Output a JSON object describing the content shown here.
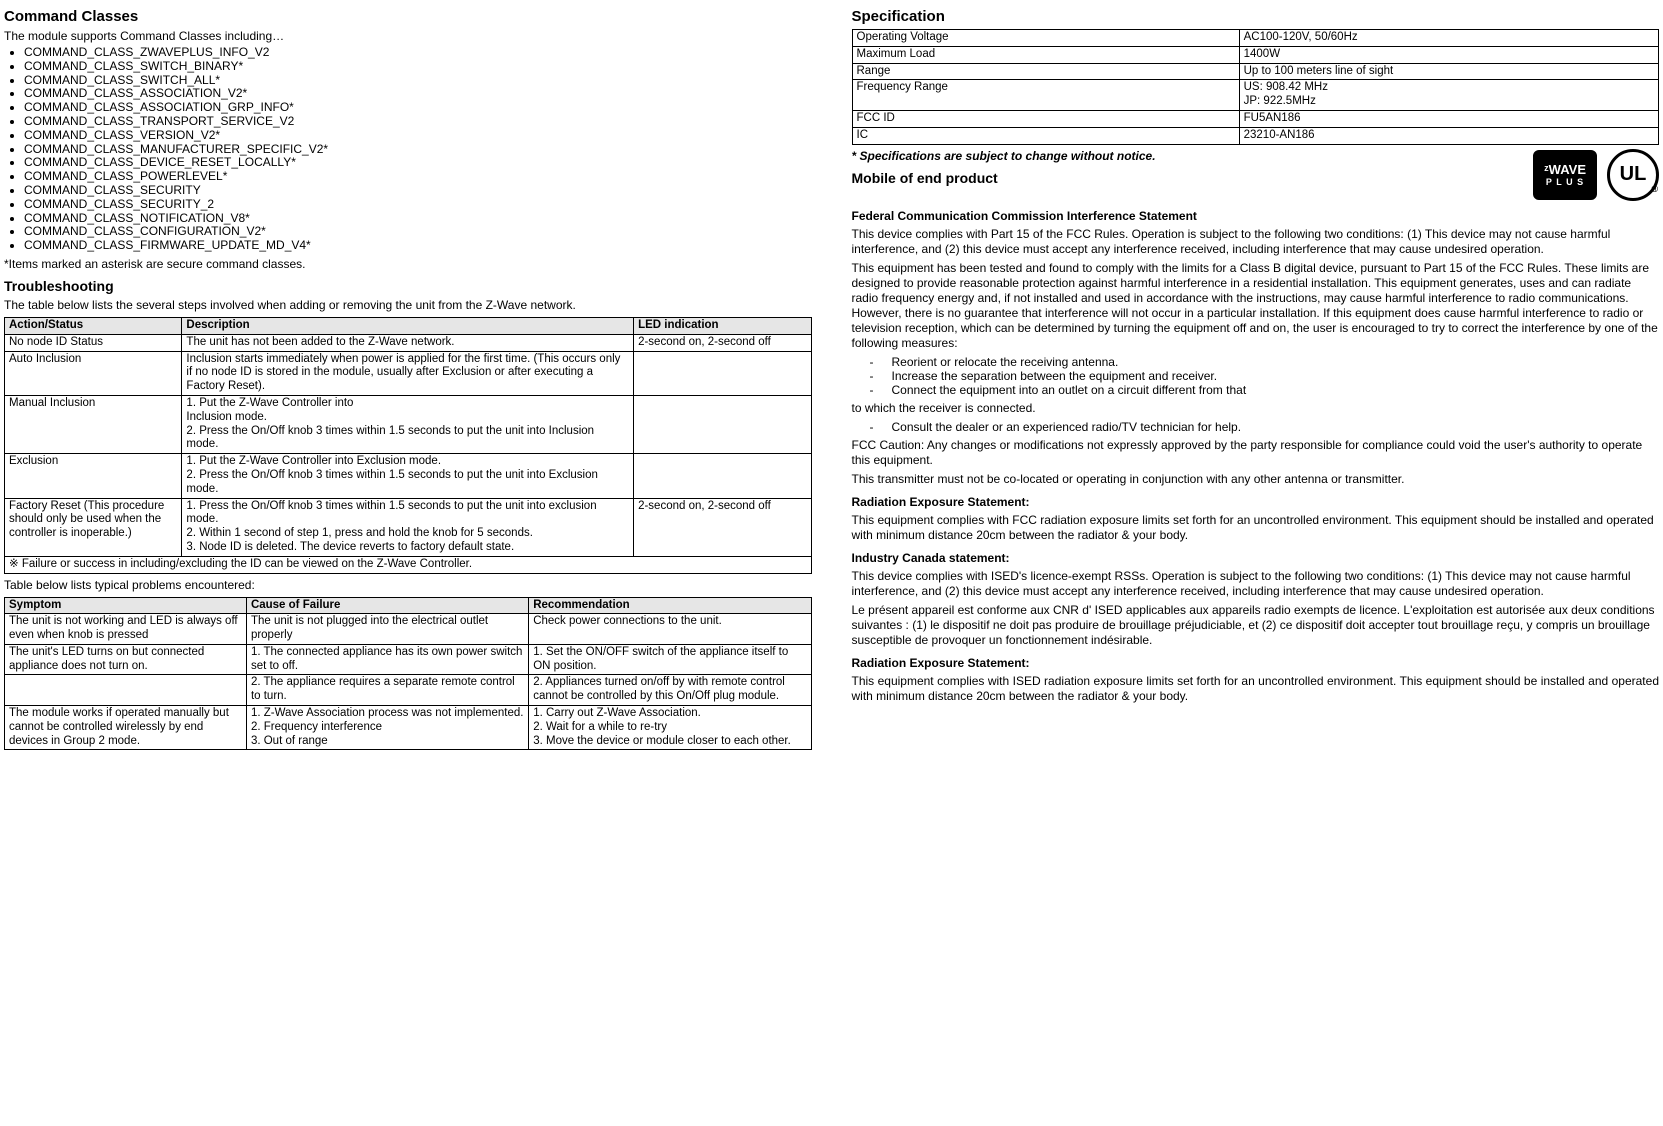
{
  "left": {
    "title1": "Command Classes",
    "intro1": "The module supports Command Classes including…",
    "commands": [
      "COMMAND_CLASS_ZWAVEPLUS_INFO_V2",
      "COMMAND_CLASS_SWITCH_BINARY*",
      "COMMAND_CLASS_SWITCH_ALL*",
      "COMMAND_CLASS_ASSOCIATION_V2*",
      "COMMAND_CLASS_ASSOCIATION_GRP_INFO*",
      "COMMAND_CLASS_TRANSPORT_SERVICE_V2",
      "COMMAND_CLASS_VERSION_V2*",
      "COMMAND_CLASS_MANUFACTURER_SPECIFIC_V2*",
      "COMMAND_CLASS_DEVICE_RESET_LOCALLY*",
      "COMMAND_CLASS_POWERLEVEL*",
      "COMMAND_CLASS_SECURITY",
      "COMMAND_CLASS_SECURITY_2",
      "COMMAND_CLASS_NOTIFICATION_V8*",
      "COMMAND_CLASS_CONFIGURATION_V2*",
      "COMMAND_CLASS_FIRMWARE_UPDATE_MD_V4*"
    ],
    "asterisk_note": "*Items marked an asterisk are secure command classes.",
    "title2": "Troubleshooting",
    "intro2": "The table below lists the several steps involved when adding or removing the unit   from the Z-Wave network.",
    "t1_headers": [
      "Action/Status",
      "Description",
      "LED indication"
    ],
    "t1_rows": [
      [
        "No node ID Status",
        "The unit has not been added to the Z-Wave network.",
        "2-second on, 2-second off"
      ],
      [
        "Auto Inclusion",
        "Inclusion starts immediately when power is applied for the first time. (This occurs only if no node ID is stored in the module, usually after Exclusion or after executing a Factory Reset).",
        ""
      ],
      [
        "Manual Inclusion",
        "1.  Put the Z-Wave Controller into\n        Inclusion mode.\n2.  Press the On/Off knob 3 times within 1.5 seconds to put the unit into Inclusion mode.",
        ""
      ],
      [
        "Exclusion",
        "1. Put the Z-Wave Controller into Exclusion mode.\n2. Press the On/Off knob 3 times within 1.5 seconds to put the unit into Exclusion mode.",
        ""
      ],
      [
        "Factory Reset (This procedure should only be used when the controller is inoperable.)",
        "1. Press the On/Off knob 3 times within 1.5 seconds to put the unit into exclusion mode.\n2.   Within 1 second of step 1, press and hold the knob for 5 seconds.\n3.   Node ID is deleted. The device reverts to factory default state.",
        "2-second on, 2-second off"
      ]
    ],
    "t1_footer": "※ Failure or success in including/excluding the ID can be viewed on the Z-Wave Controller.",
    "intro3": "Table below lists typical problems encountered:",
    "t2_headers": [
      "Symptom",
      "Cause of Failure",
      "Recommendation"
    ],
    "t2_rows": [
      [
        "The unit is not working and LED is always off even when knob is pressed",
        "      The unit is not plugged into the electrical outlet properly",
        "Check power connections to the unit."
      ],
      [
        "The unit's LED turns on but connected appliance does not turn on.",
        "1. The connected appliance has its own power switch set to off.",
        "1. Set the ON/OFF switch of the appliance itself to ON position."
      ],
      [
        "",
        "2. The appliance requires a separate remote control to turn.",
        "2. Appliances turned on/off by with remote control cannot be controlled by this On/Off plug module."
      ],
      [
        "The module works if operated manually but cannot be controlled wirelessly by end devices in Group 2 mode.",
        "1. Z-Wave Association process was not implemented.\n2. Frequency interference\n3. Out of range",
        "1. Carry out Z-Wave Association.\n2. Wait for a while to re-try\n3. Move the device or module closer to each other."
      ]
    ]
  },
  "right": {
    "title1": "Specification",
    "spec_rows": [
      [
        "Operating Voltage",
        "AC100-120V, 50/60Hz"
      ],
      [
        "Maximum Load",
        "1400W"
      ],
      [
        "Range",
        "Up to 100 meters line of sight"
      ],
      [
        "Frequency Range",
        "US: 908.42 MHz\nJP: 922.5MHz"
      ],
      [
        "FCC ID",
        "FU5AN186"
      ],
      [
        "IC",
        "23210-AN186"
      ]
    ],
    "spec_note": "* Specifications are subject to change without notice.",
    "title2": "Mobile of end product",
    "fcc_header": "Federal Communication Commission Interference Statement",
    "fcc_p1": "This device complies with Part 15 of the FCC Rules. Operation is subject to the following two conditions: (1) This device may not cause harmful interference, and (2) this device must accept any interference received, including interference that may cause undesired operation.",
    "fcc_p2": "This equipment has been tested and found to comply with the limits for a Class B digital device, pursuant to Part 15 of the FCC Rules.   These limits are designed to provide reasonable protection against harmful interference in a residential installation. This equipment generates, uses and can radiate radio frequency energy and, if not installed and used in accordance with the instructions, may cause harmful interference to radio communications.   However, there is no guarantee that interference will not occur in a particular installation.   If this equipment does cause harmful interference to radio or television reception, which can be determined by turning the equipment off and on, the user is encouraged to try to correct the interference by one of the following measures:",
    "measures": [
      "Reorient or relocate the receiving antenna.",
      "Increase the separation between the equipment and receiver.",
      "Connect the equipment into an outlet on a circuit different from that"
    ],
    "measures_tail1": "to which the receiver is connected.",
    "measures4": "Consult the dealer or an experienced radio/TV technician for help.",
    "fcc_caution": "FCC Caution: Any changes or modifications not expressly approved by the party responsible for compliance could void the user's authority to operate this equipment.",
    "fcc_tx": "This transmitter must not be co-located or operating in conjunction with any other antenna or transmitter.",
    "rad_header": "Radiation Exposure Statement:",
    "rad_p1": "This equipment complies with FCC radiation exposure limits set forth for an uncontrolled environment. This equipment should be installed and operated with minimum distance 20cm between the radiator & your body.",
    "ic_header": "Industry Canada statement:",
    "ic_p1": "This device complies with ISED's licence-exempt RSSs. Operation is subject to the following two conditions: (1) This device may not cause harmful interference, and (2) this device must accept any interference received, including interference that may cause undesired operation.",
    "ic_p2": "Le présent appareil est conforme aux CNR d' ISED applicables aux appareils radio exempts de licence. L'exploitation est autorisée aux deux conditions suivantes : (1) le dispositif ne doit pas produire de brouillage préjudiciable, et (2) ce dispositif doit accepter tout brouillage reçu, y compris un brouillage susceptible de provoquer un fonctionnement indésirable.",
    "rad2_header": "Radiation Exposure Statement:",
    "rad2_p1": "This equipment complies with ISED radiation exposure limits set forth for an uncontrolled environment. This equipment should be installed and operated with minimum distance 20cm between the radiator & your body.",
    "badge_zwave_top": "ᶻWAVE",
    "badge_zwave_bot": "P L U S",
    "badge_ul": "UL"
  }
}
